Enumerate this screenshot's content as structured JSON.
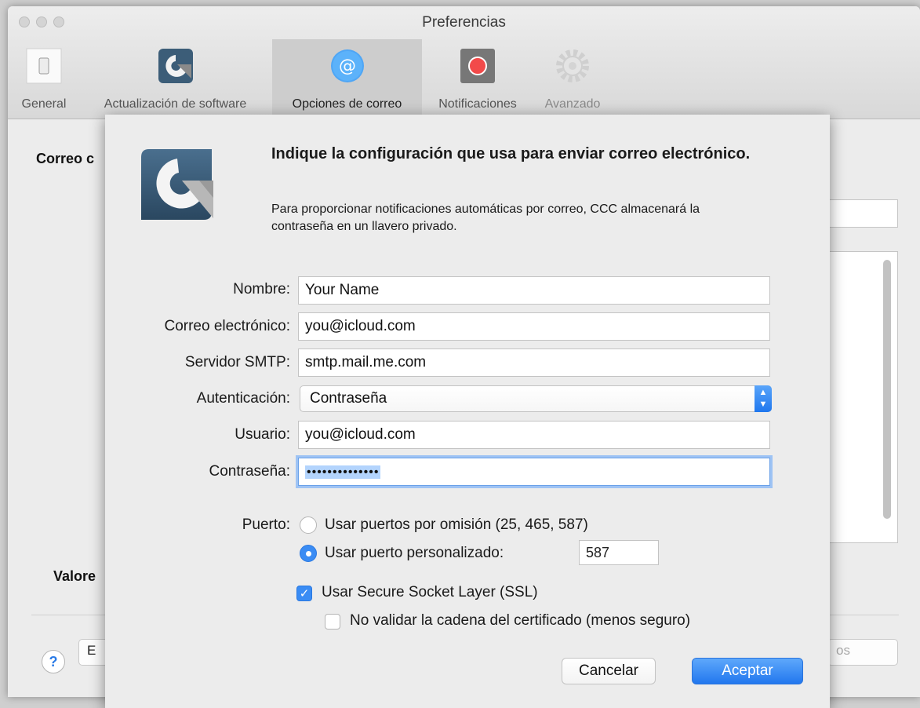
{
  "window": {
    "title": "Preferencias"
  },
  "toolbar": {
    "items": [
      {
        "label": "General",
        "icon": "switch-icon"
      },
      {
        "label": "Actualización de software",
        "icon": "ccc-update-icon"
      },
      {
        "label": "Opciones de correo",
        "icon": "at-icon"
      },
      {
        "label": "Notificaciones",
        "icon": "record-icon"
      },
      {
        "label": "Avanzado",
        "icon": "gear-icon"
      }
    ],
    "active": "Opciones de correo"
  },
  "background": {
    "section1_partial": "Correo c",
    "section2_partial": "Valore",
    "partial_button": "E",
    "partial_right_button": "os"
  },
  "sheet": {
    "heading": "Indique la configuración que usa para enviar correo electrónico.",
    "subtext": "Para proporcionar notificaciones automáticas por correo, CCC almacenará la contraseña en un llavero privado.",
    "fields": {
      "name_label": "Nombre:",
      "name_value": "Your Name",
      "email_label": "Correo electrónico:",
      "email_value": "you@icloud.com",
      "smtp_label": "Servidor SMTP:",
      "smtp_value": "smtp.mail.me.com",
      "auth_label": "Autenticación:",
      "auth_value": "Contraseña",
      "user_label": "Usuario:",
      "user_value": "you@icloud.com",
      "password_label": "Contraseña:",
      "password_value": "••••••••••••••"
    },
    "port": {
      "label": "Puerto:",
      "option_default": "Usar puertos por omisión (25, 465, 587)",
      "option_custom": "Usar puerto personalizado:",
      "custom_value": "587",
      "selected": "custom"
    },
    "ssl": {
      "label": "Usar Secure Socket Layer (SSL)",
      "checked": true,
      "no_validate_label": "No validar la cadena del certificado (menos seguro)",
      "no_validate_checked": false
    },
    "buttons": {
      "cancel": "Cancelar",
      "accept": "Aceptar"
    }
  },
  "help": "?",
  "colors": {
    "accent": "#2a7cf0",
    "selection": "#b3d4fd"
  }
}
